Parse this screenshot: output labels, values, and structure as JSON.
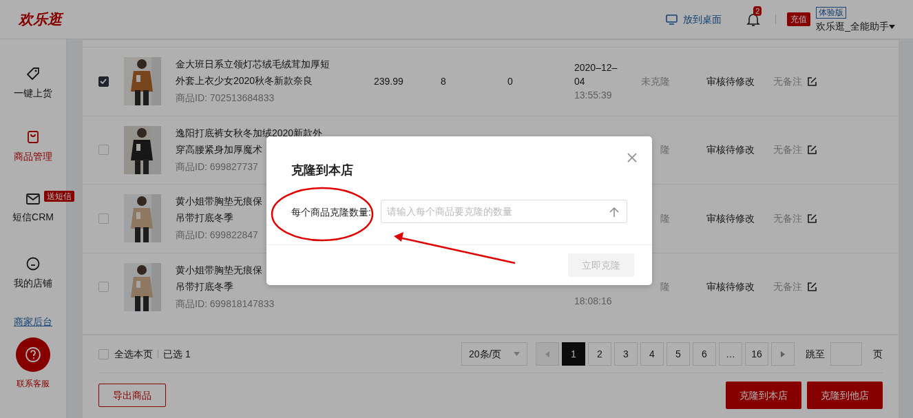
{
  "header": {
    "logo": "欢乐逛",
    "desktop_link": "放到桌面",
    "notification_count": "2",
    "recharge": "充值",
    "edition": "体验版",
    "user": "欢乐逛_全能助手"
  },
  "sidebar": {
    "items": [
      {
        "label": "一键上货",
        "selected": false
      },
      {
        "label": "商品管理",
        "selected": true
      },
      {
        "label": "短信CRM",
        "selected": false,
        "badge": "送短信"
      },
      {
        "label": "我的店铺",
        "selected": false
      }
    ],
    "merchant_link": "商家后台",
    "support": "联系客服"
  },
  "rows": [
    {
      "checked": true,
      "title": "金大班日系立领灯芯绒毛绒茸加厚短外套上衣少女2020秋冬新款奈良",
      "product_id": "商品ID: 702513684833",
      "price": "239.99",
      "column_4": "8",
      "column_5": "0",
      "date": "2020–12–04",
      "time": "13:55:39",
      "clone_status": "未克隆",
      "audit": "审核待修改",
      "note": "无备注"
    },
    {
      "checked": false,
      "title": "逸阳打底裤女秋冬加绒2020新款外",
      "title_2": "穿高腰紧身加厚魔术",
      "product_id": "商品ID: 699827737",
      "clone_status": "隆",
      "audit": "审核待修改",
      "note": "无备注"
    },
    {
      "checked": false,
      "title": "黄小姐带胸垫无痕保",
      "title_2": "吊带打底冬季",
      "product_id": "商品ID: 699822847",
      "clone_status": "隆",
      "audit": "审核待修改",
      "note": "无备注"
    },
    {
      "checked": false,
      "title": "黄小姐带胸垫无痕保",
      "title_2": "吊带打底冬季",
      "product_id": "商品ID: 699818147833",
      "time": "18:08:16",
      "clone_status": "隆",
      "audit": "审核待修改",
      "note": "无备注"
    }
  ],
  "footer": {
    "select_all": {
      "label": "全选本页",
      "checked": false
    },
    "selected_count": "已选 1",
    "page_size": "20条/页",
    "pages": [
      {
        "label": "1",
        "selected": true
      },
      {
        "label": "2",
        "selected": false
      },
      {
        "label": "3",
        "selected": false
      },
      {
        "label": "4",
        "selected": false
      },
      {
        "label": "5",
        "selected": false
      },
      {
        "label": "6",
        "selected": false
      },
      {
        "label": "…",
        "selected": false
      },
      {
        "label": "16",
        "selected": false
      }
    ],
    "jump_label": "跳至",
    "page_unit": "页",
    "export_button": "导出商品",
    "clone_here_button": "克隆到本店",
    "clone_other_button": "克隆到他店"
  },
  "modal": {
    "title": "克隆到本店",
    "field_label": "每个商品克隆数量:",
    "placeholder": "请输入每个商品要克隆的数量",
    "submit": "立即克隆",
    "submit_disabled": true
  }
}
